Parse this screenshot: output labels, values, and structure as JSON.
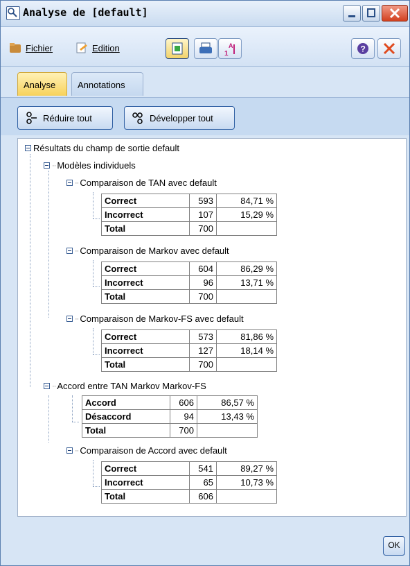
{
  "window": {
    "title": "Analyse de [default]"
  },
  "toolbar": {
    "file_label": "Fichier",
    "edit_label": "Edition"
  },
  "tabs": [
    {
      "label": "Analyse"
    },
    {
      "label": "Annotations"
    }
  ],
  "actions": {
    "collapse_label": "Réduire tout",
    "expand_label": "Développer tout"
  },
  "tree": {
    "root": "Résultats du champ de sortie default",
    "individual": "Modèles individuels",
    "comparisons": [
      {
        "title": "Comparaison de TAN avec default",
        "rows": [
          {
            "label": "Correct",
            "count": "593",
            "pct": "84,71 %"
          },
          {
            "label": "Incorrect",
            "count": "107",
            "pct": "15,29 %"
          },
          {
            "label": "Total",
            "count": "700",
            "pct": ""
          }
        ]
      },
      {
        "title": "Comparaison de Markov avec default",
        "rows": [
          {
            "label": "Correct",
            "count": "604",
            "pct": "86,29 %"
          },
          {
            "label": "Incorrect",
            "count": "96",
            "pct": "13,71 %"
          },
          {
            "label": "Total",
            "count": "700",
            "pct": ""
          }
        ]
      },
      {
        "title": "Comparaison de Markov-FS avec default",
        "rows": [
          {
            "label": "Correct",
            "count": "573",
            "pct": "81,86 %"
          },
          {
            "label": "Incorrect",
            "count": "127",
            "pct": "18,14 %"
          },
          {
            "label": "Total",
            "count": "700",
            "pct": ""
          }
        ]
      }
    ],
    "agreement": {
      "title": "Accord entre  TAN Markov Markov-FS",
      "rows": [
        {
          "label": "Accord",
          "count": "606",
          "pct": "86,57 %"
        },
        {
          "label": "Désaccord",
          "count": "94",
          "pct": "13,43 %"
        },
        {
          "label": "Total",
          "count": "700",
          "pct": ""
        }
      ]
    },
    "agreement_comparison": {
      "title": "Comparaison de Accord avec default",
      "rows": [
        {
          "label": "Correct",
          "count": "541",
          "pct": "89,27 %"
        },
        {
          "label": "Incorrect",
          "count": "65",
          "pct": "10,73 %"
        },
        {
          "label": "Total",
          "count": "606",
          "pct": ""
        }
      ]
    }
  },
  "footer": {
    "ok_label": "OK"
  },
  "colors": {
    "accent": "#f7d25c",
    "close": "#d2401f",
    "frame": "#d7e5f5"
  }
}
